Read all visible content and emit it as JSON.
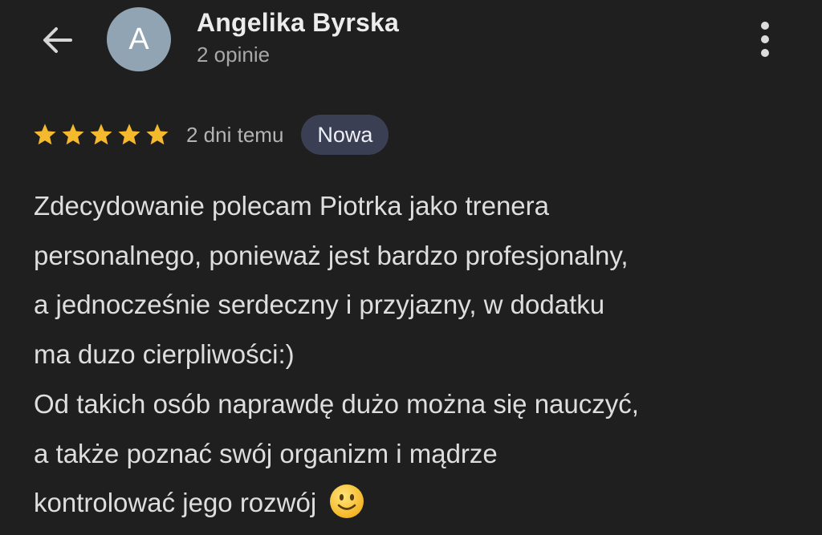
{
  "header": {
    "back_icon": "arrow-left-icon",
    "avatar_initial": "A",
    "avatar_color": "#90a4b4",
    "author_name": "Angelika Byrska",
    "author_reviews": "2 opinie",
    "more_icon": "more-vertical-icon"
  },
  "review": {
    "rating": 5,
    "rating_max": 5,
    "star_color": "#f5b92e",
    "date": "2 dni temu",
    "badge": "Nowa",
    "lines": [
      "Zdecydowanie polecam Piotrka jako trenera",
      "personalnego, ponieważ jest bardzo profesjonalny,",
      "a jednocześnie serdeczny i przyjazny, w dodatku",
      "ma duzo cierpliwości:)",
      "Od takich osób naprawdę dużo można się nauczyć,",
      "a także poznać swój organizm i mądrze",
      "kontrolować jego rozwój"
    ],
    "emoji_icon": "slightly-smiling-face-icon"
  }
}
